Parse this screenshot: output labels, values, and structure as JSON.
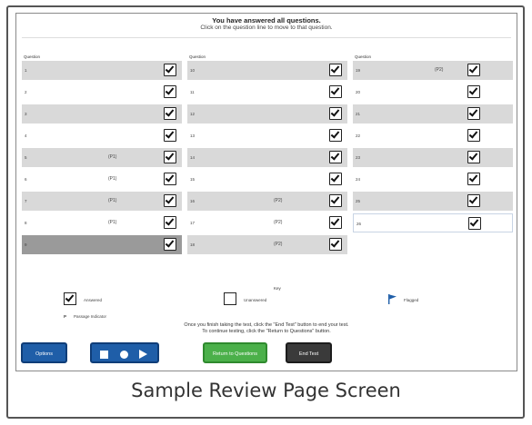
{
  "header": {
    "line1": "You have answered all questions.",
    "line2": "Click on the question line to move to that question."
  },
  "columns": [
    {
      "label": "Question",
      "rows": [
        {
          "num": "1",
          "flag": "",
          "shade": "shaded"
        },
        {
          "num": "2",
          "flag": "",
          "shade": ""
        },
        {
          "num": "3",
          "flag": "",
          "shade": "shaded"
        },
        {
          "num": "4",
          "flag": "",
          "shade": ""
        },
        {
          "num": "5",
          "flag": "(P1)",
          "shade": "shaded"
        },
        {
          "num": "6",
          "flag": "(P1)",
          "shade": ""
        },
        {
          "num": "7",
          "flag": "(P1)",
          "shade": "shaded"
        },
        {
          "num": "8",
          "flag": "(P1)",
          "shade": ""
        },
        {
          "num": "9",
          "flag": "",
          "shade": "current"
        }
      ]
    },
    {
      "label": "Question",
      "rows": [
        {
          "num": "10",
          "flag": "",
          "shade": "shaded"
        },
        {
          "num": "11",
          "flag": "",
          "shade": ""
        },
        {
          "num": "12",
          "flag": "",
          "shade": "shaded"
        },
        {
          "num": "13",
          "flag": "",
          "shade": ""
        },
        {
          "num": "14",
          "flag": "",
          "shade": "shaded"
        },
        {
          "num": "15",
          "flag": "",
          "shade": ""
        },
        {
          "num": "16",
          "flag": "(P2)",
          "shade": "shaded"
        },
        {
          "num": "17",
          "flag": "(P2)",
          "shade": ""
        },
        {
          "num": "18",
          "flag": "(P2)",
          "shade": "shaded"
        }
      ]
    },
    {
      "label": "Question",
      "rows": [
        {
          "num": "19",
          "flag": "(P2)",
          "shade": "shaded"
        },
        {
          "num": "20",
          "flag": "",
          "shade": ""
        },
        {
          "num": "21",
          "flag": "",
          "shade": "shaded"
        },
        {
          "num": "22",
          "flag": "",
          "shade": ""
        },
        {
          "num": "23",
          "flag": "",
          "shade": "shaded"
        },
        {
          "num": "24",
          "flag": "",
          "shade": ""
        },
        {
          "num": "25",
          "flag": "",
          "shade": "shaded"
        },
        {
          "num": "26",
          "flag": "",
          "shade": "bordered"
        }
      ]
    }
  ],
  "key": {
    "title": "Key",
    "answered": "Answered",
    "unanswered": "Unanswered",
    "flagged": "Flagged",
    "passage_letter": "P",
    "passage_label": "Passage Indicator"
  },
  "instructions": {
    "line1": "Once you finish taking the test, click the \"End Test\" button to end your test.",
    "line2": "To continue testing, click the \"Return to Questions\" button."
  },
  "buttons": {
    "options": "Options",
    "return": "Return to Questions",
    "end": "End Test"
  },
  "caption": "Sample Review Page Screen",
  "colors": {
    "blue_button": "#1f5ea8",
    "green_button": "#4bb04a",
    "dark_button": "#3a3a3a",
    "flag": "#1f5ea8"
  },
  "icons": [
    "check-icon",
    "flag-icon",
    "stop-icon",
    "record-icon",
    "play-icon"
  ]
}
